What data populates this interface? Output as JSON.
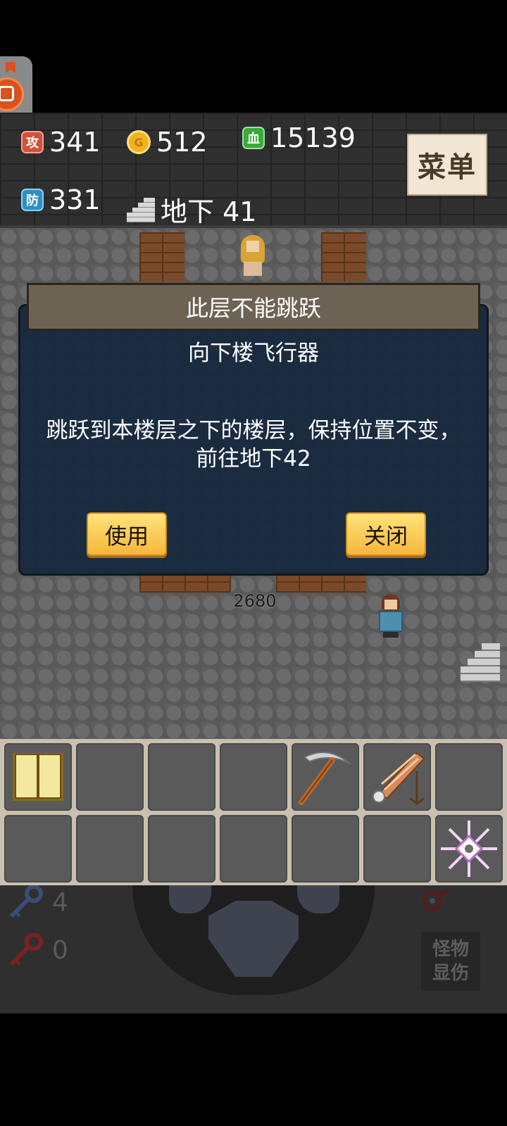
{
  "status": {
    "attack_badge": "攻",
    "attack": "341",
    "gold_badge": "G",
    "gold": "512",
    "hp_badge": "血",
    "hp": "15139",
    "defense_badge": "防",
    "defense": "331",
    "floor": "地下 41"
  },
  "menu_label": "菜单",
  "map": {
    "monster_damage": "2680"
  },
  "dialog": {
    "title": "此层不能跳跃",
    "item_name": "向下楼飞行器",
    "description": "跳跃到本楼层之下的楼层，保持位置不变，前往地下42",
    "use_label": "使用",
    "close_label": "关闭"
  },
  "inventory": {
    "slots": [
      "monster-book",
      "",
      "",
      "",
      "pickaxe",
      "down-floor-flyer",
      "",
      "",
      "",
      "",
      "",
      "",
      "",
      "snowflake-orb"
    ]
  },
  "keys": {
    "blue_count": "4",
    "red_count": "0"
  },
  "monster_toggle": {
    "line1": "怪物",
    "line2": "显伤"
  },
  "colors": {
    "dialog_bg": "#16283e",
    "title_bar": "#6d6355",
    "button_gold": "#f6b73a",
    "attack_badge": "#d0523a",
    "defense_badge": "#2c8fc4",
    "hp_badge": "#3aa83a"
  }
}
